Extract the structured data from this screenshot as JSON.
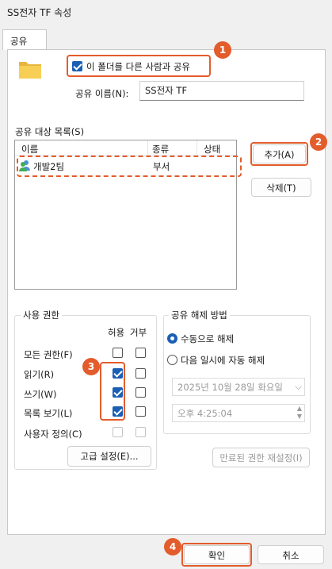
{
  "window": {
    "title": "SS전자 TF 속성"
  },
  "tabs": [
    {
      "label": "공유"
    }
  ],
  "share": {
    "share_folder_label": "이 폴더를 다른 사람과 공유",
    "share_name_label": "공유 이름(N):",
    "share_name_value": "SS전자 TF",
    "share_list_label": "공유 대상 목록(S)",
    "columns": [
      "이름",
      "종류",
      "상태"
    ],
    "entries": [
      {
        "name": "개발2팀",
        "type": "부서",
        "status": ""
      }
    ],
    "add_button": "추가(A)",
    "delete_button": "삭제(T)"
  },
  "permissions": {
    "group_title": "사용 권한",
    "allow_header": "허용",
    "deny_header": "거부",
    "rows": [
      {
        "label": "모든 권한(F)",
        "allow": false,
        "deny": false,
        "disabled": false
      },
      {
        "label": "읽기(R)",
        "allow": true,
        "deny": false,
        "disabled": false
      },
      {
        "label": "쓰기(W)",
        "allow": true,
        "deny": false,
        "disabled": false
      },
      {
        "label": "목록 보기(L)",
        "allow": true,
        "deny": false,
        "disabled": false
      },
      {
        "label": "사용자 정의(C)",
        "allow": false,
        "deny": false,
        "disabled": true
      }
    ],
    "advanced_button": "고급 설정(E)..."
  },
  "unshare": {
    "group_title": "공유 해제 방법",
    "manual_label": "수동으로 해제",
    "manual_selected": true,
    "auto_label": "다음 일시에 자동 해제",
    "date_value": "2025년 10월 28일 화요일",
    "time_value": "오후   4:25:04",
    "reset_expired_button": "만료된 권한 재설정(I)"
  },
  "buttons": {
    "ok": "확인",
    "cancel": "취소"
  },
  "badges": [
    "1",
    "2",
    "3",
    "4"
  ],
  "colors": {
    "accent": "#1a5fb4",
    "highlight": "#e35c2c"
  }
}
